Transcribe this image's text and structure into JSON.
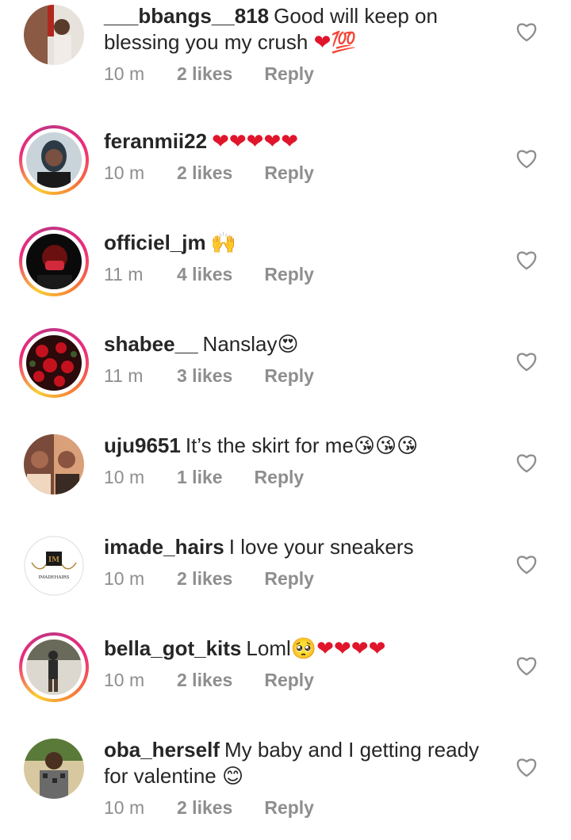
{
  "comments": [
    {
      "username": "___bbangs__818",
      "text": "Good will keep on blessing you my crush ❤️💯",
      "time": "10 m",
      "likes": "2 likes",
      "reply": "Reply",
      "avatar_style": "plain",
      "avatar_colors": [
        "#8a5a44",
        "#e8e2dc",
        "#b0281e"
      ]
    },
    {
      "username": "feranmii22",
      "text": "❤️❤️❤️❤️❤️",
      "time": "10 m",
      "likes": "2 likes",
      "reply": "Reply",
      "avatar_style": "story",
      "avatar_colors": [
        "#2b3a44",
        "#c9d4da",
        "#1a1a1a"
      ]
    },
    {
      "username": "officiel_jm",
      "text": "🙌",
      "time": "11 m",
      "likes": "4 likes",
      "reply": "Reply",
      "avatar_style": "story",
      "avatar_colors": [
        "#0a0a0a",
        "#d22a3a",
        "#6a1010"
      ]
    },
    {
      "username": "shabee__",
      "text": "Nanslay😍",
      "time": "11 m",
      "likes": "3 likes",
      "reply": "Reply",
      "avatar_style": "story",
      "avatar_colors": [
        "#2a0a0a",
        "#c3121e",
        "#3d5a2a"
      ]
    },
    {
      "username": "uju9651",
      "text": "It’s the skirt for me😘😘😘",
      "time": "10 m",
      "likes": "1 like",
      "reply": "Reply",
      "avatar_style": "plain",
      "avatar_colors": [
        "#7a4a3a",
        "#d9a07a",
        "#3a2a24"
      ]
    },
    {
      "username": "imade_hairs",
      "text": "I love your sneakers",
      "time": "10 m",
      "likes": "2 likes",
      "reply": "Reply",
      "avatar_style": "logo",
      "avatar_logo_text": "IMADEHAIRS",
      "avatar_colors": [
        "#ffffff",
        "#b08a3a",
        "#1a1a1a"
      ]
    },
    {
      "username": "bella_got_kits",
      "text": "Loml🥺❤️❤️❤️❤️",
      "time": "10 m",
      "likes": "2 likes",
      "reply": "Reply",
      "avatar_style": "story",
      "avatar_colors": [
        "#6a6a5a",
        "#dcd8d0",
        "#2a2a2a"
      ]
    },
    {
      "username": "oba_herself",
      "text": "My baby and I getting ready for valentine 😊",
      "time": "10 m",
      "likes": "2 likes",
      "reply": "Reply",
      "avatar_style": "plain",
      "avatar_colors": [
        "#5a7a3a",
        "#d8c8a0",
        "#2a2a2a"
      ]
    }
  ],
  "colors": {
    "text": "#262626",
    "meta": "#8e8e8e",
    "heart_outline": "#8e8e8e",
    "emoji_heart": "#e0152b"
  }
}
